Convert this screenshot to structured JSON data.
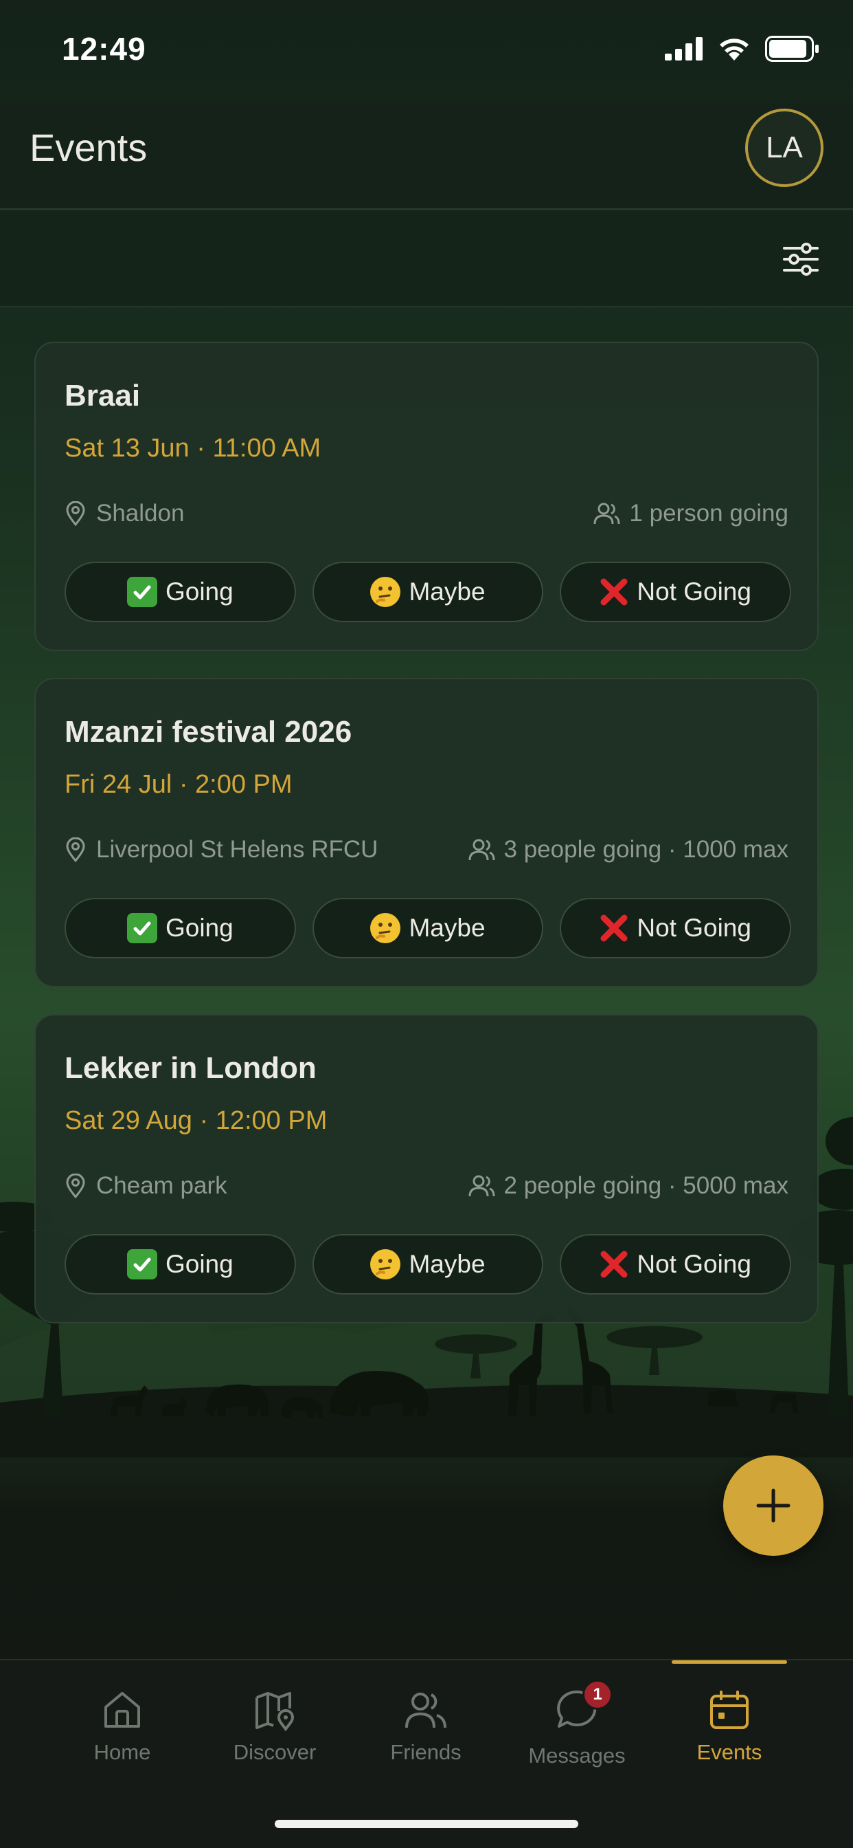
{
  "status_bar": {
    "time": "12:49"
  },
  "header": {
    "title": "Events",
    "avatar_initials": "LA"
  },
  "events": [
    {
      "title": "Braai",
      "datetime": "Sat 13 Jun · 11:00 AM",
      "location": "Shaldon",
      "attendees": "1 person going",
      "rsvp": {
        "going": "Going",
        "maybe": "Maybe",
        "not_going": "Not Going"
      }
    },
    {
      "title": "Mzanzi festival 2026",
      "datetime": "Fri 24 Jul · 2:00 PM",
      "location": "Liverpool St Helens RFCU",
      "attendees": "3 people going · 1000 max",
      "rsvp": {
        "going": "Going",
        "maybe": "Maybe",
        "not_going": "Not Going"
      }
    },
    {
      "title": "Lekker in London",
      "datetime": "Sat 29 Aug · 12:00 PM",
      "location": "Cheam park",
      "attendees": "2 people going · 5000 max",
      "rsvp": {
        "going": "Going",
        "maybe": "Maybe",
        "not_going": "Not Going"
      }
    }
  ],
  "nav": {
    "items": [
      {
        "label": "Home",
        "icon": "home-icon"
      },
      {
        "label": "Discover",
        "icon": "map-pin-icon"
      },
      {
        "label": "Friends",
        "icon": "users-icon"
      },
      {
        "label": "Messages",
        "icon": "chat-bubble-icon",
        "badge": "1"
      },
      {
        "label": "Events",
        "icon": "calendar-icon",
        "active": true
      }
    ]
  },
  "colors": {
    "accent": "#d3a63a",
    "background": "#142219",
    "card": "#1f3024",
    "badge": "#a4232a"
  }
}
